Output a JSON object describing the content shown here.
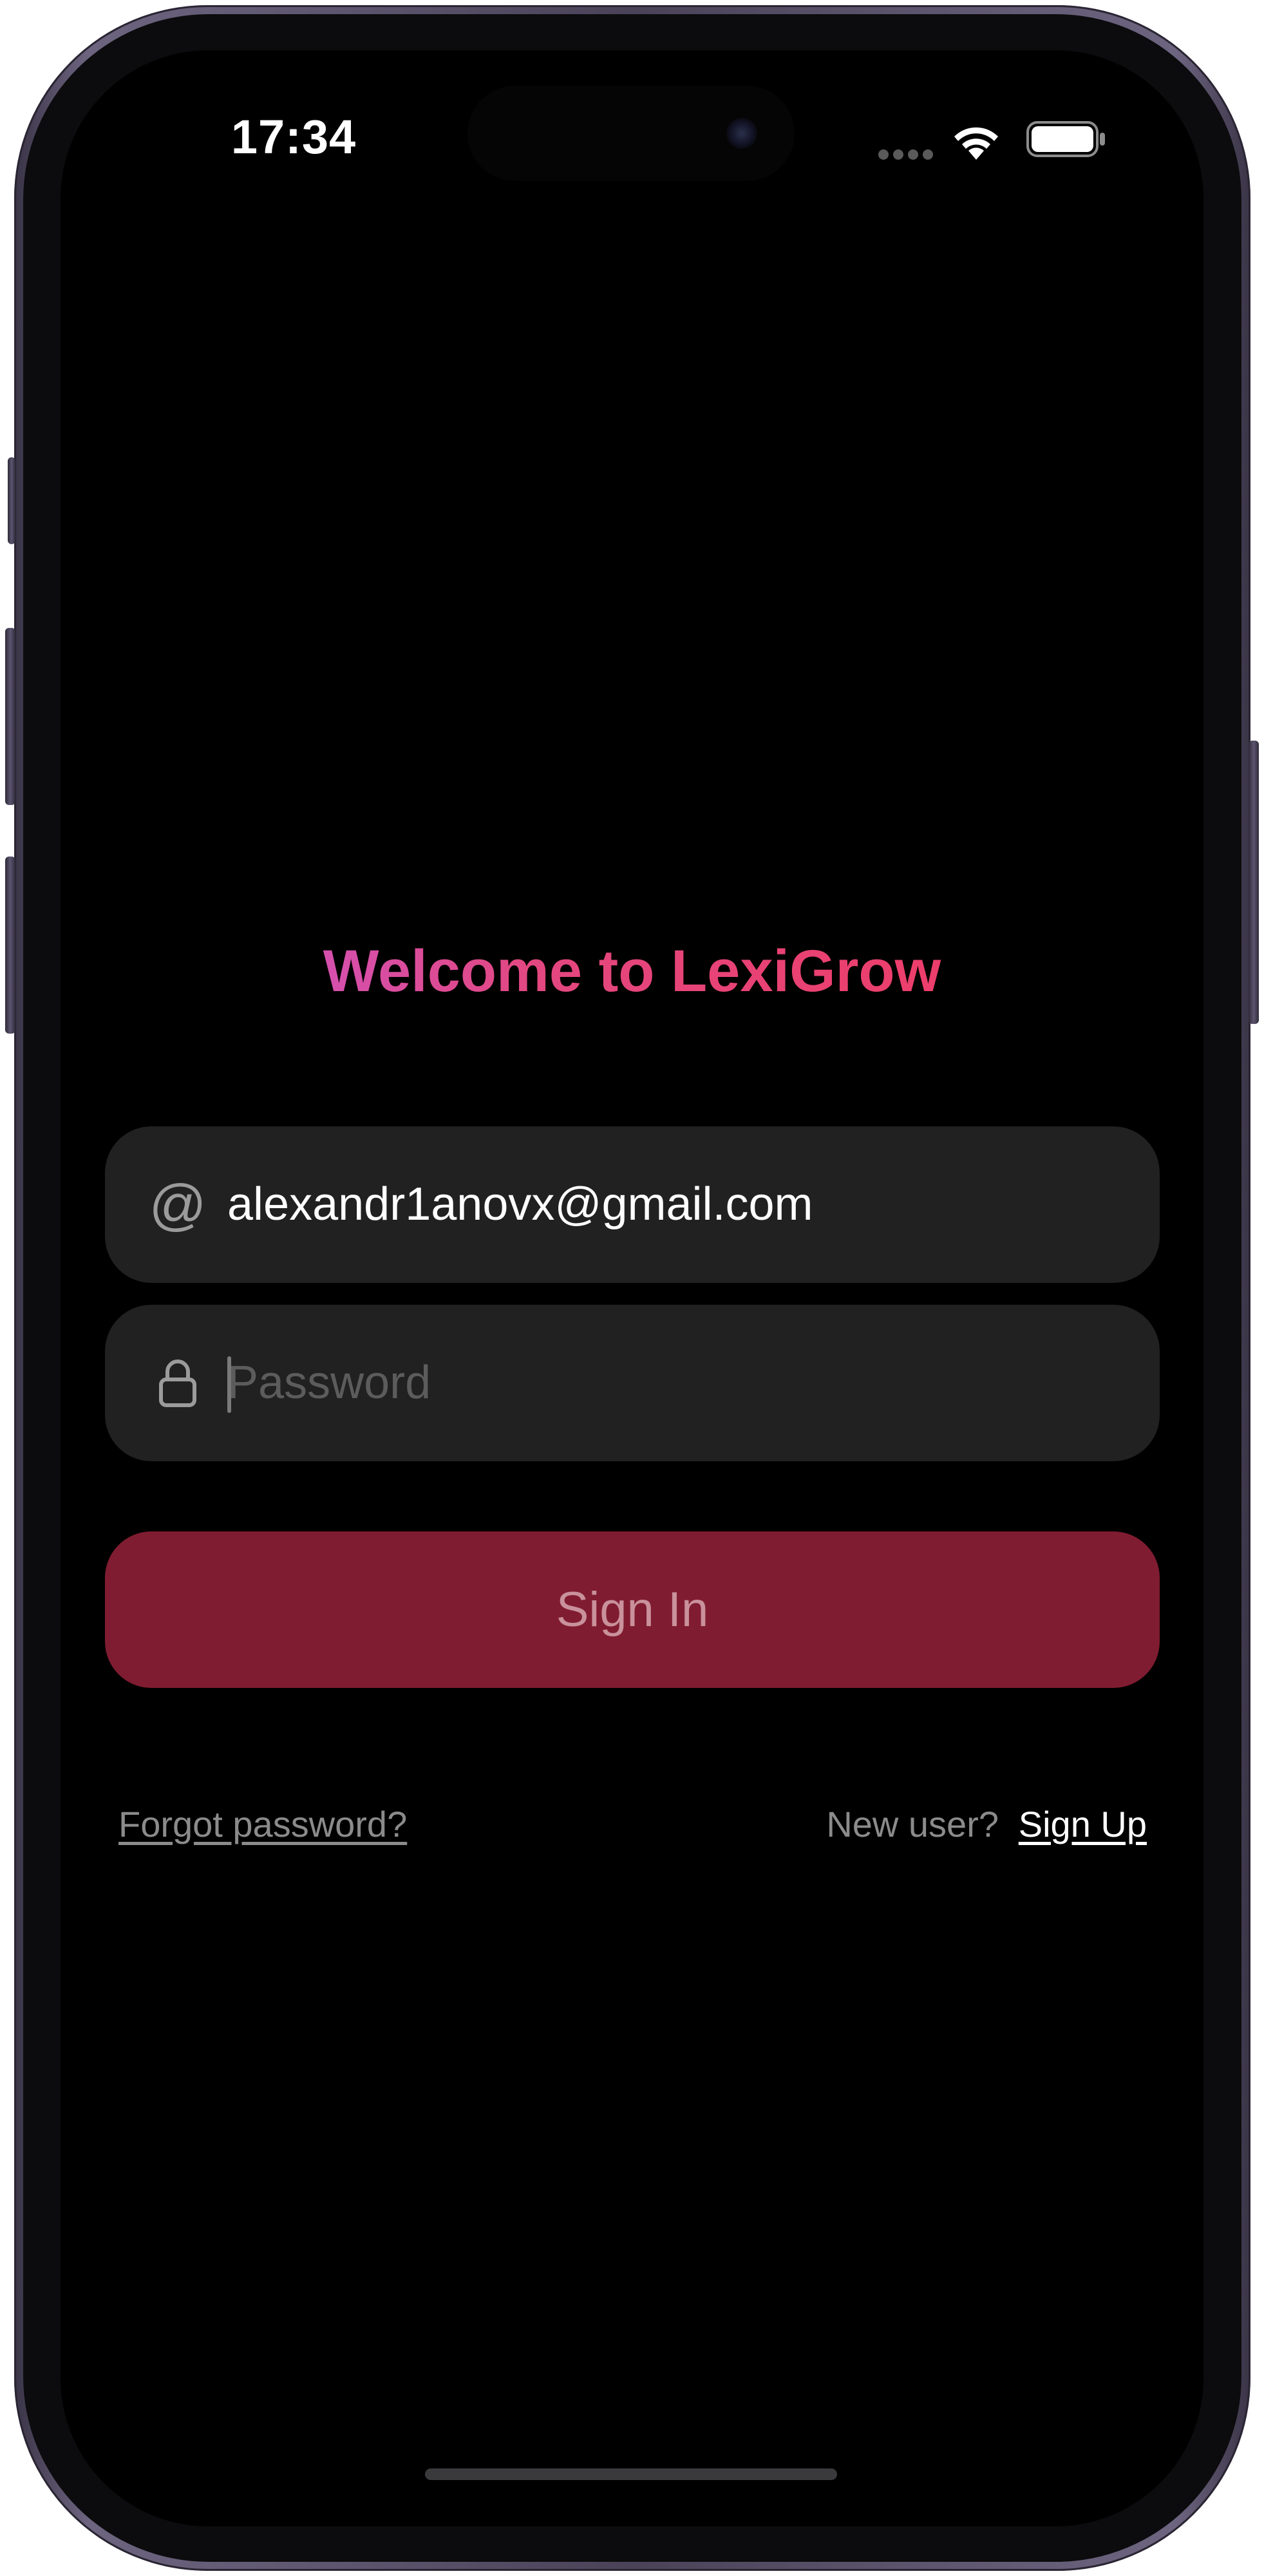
{
  "status_bar": {
    "time": "17:34",
    "icons": [
      "cellular-signal-icon",
      "wifi-icon",
      "battery-icon"
    ]
  },
  "welcome": {
    "title": "Welcome to LexiGrow"
  },
  "login_form": {
    "email": {
      "icon": "at-sign-icon",
      "value": "alexandr1anovx@gmail.com"
    },
    "password": {
      "icon": "lock-icon",
      "placeholder": "Password",
      "value": ""
    },
    "sign_in_label": "Sign In"
  },
  "links": {
    "forgot_password": "Forgot password?",
    "new_user": "New user?",
    "sign_up": "Sign Up"
  },
  "colors": {
    "background": "#000000",
    "field_background": "#212121",
    "sign_in_button": "#801c31",
    "sign_in_text": "#c9919c",
    "title_gradient_start": "#c45ae6",
    "title_gradient_end": "#f2385e"
  }
}
